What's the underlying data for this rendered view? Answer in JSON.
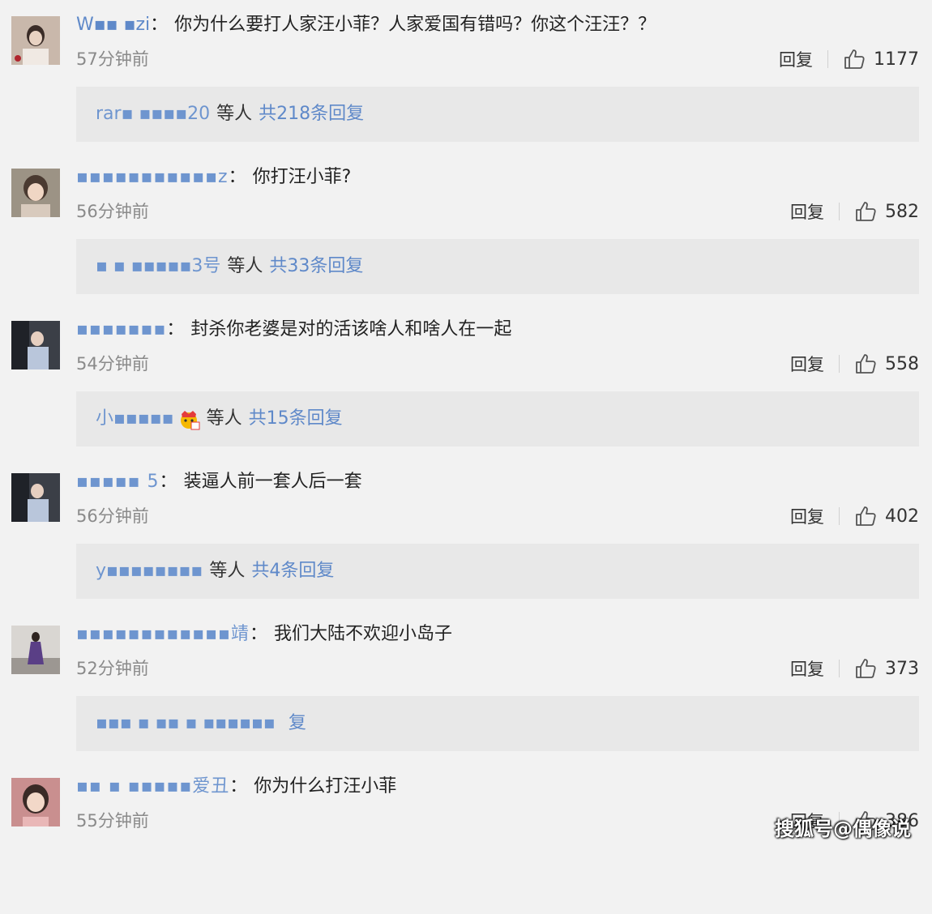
{
  "comments": [
    {
      "username": "W▪▪ ▪zi",
      "text": "你为什么要打人家汪小菲？人家爱国有错吗？你这个汪汪？？",
      "time": "57分钟前",
      "reply_label": "回复",
      "likes": "1177",
      "reply_summary": {
        "replier": "rar▪ ▪▪▪▪20",
        "etc": "等人",
        "total": "共218条回复"
      }
    },
    {
      "username": "▪▪▪▪▪▪▪▪▪▪▪z",
      "text": "你打汪小菲?",
      "time": "56分钟前",
      "reply_label": "回复",
      "likes": "582",
      "reply_summary": {
        "replier": "▪  ▪  ▪▪▪▪▪3号",
        "etc": "等人",
        "total": "共33条回复"
      }
    },
    {
      "username": "▪▪▪▪▪▪▪",
      "text": "封杀你老婆是对的活该啥人和啥人在一起",
      "time": "54分钟前",
      "reply_label": "回复",
      "likes": "558",
      "reply_summary": {
        "replier": "小▪▪▪▪▪",
        "etc": "等人",
        "total": "共15条回复"
      }
    },
    {
      "username": "▪▪▪▪▪   5",
      "text": "装逼人前一套人后一套",
      "time": "56分钟前",
      "reply_label": "回复",
      "likes": "402",
      "reply_summary": {
        "replier": "y▪▪▪▪▪▪▪▪",
        "etc": "等人",
        "total": "共4条回复"
      }
    },
    {
      "username": "▪▪▪▪▪▪▪▪▪▪▪▪靖",
      "text": "我们大陆不欢迎小岛子",
      "time": "52分钟前",
      "reply_label": "回复",
      "likes": "373",
      "reply_summary": {
        "replier": "▪▪▪ ▪ ▪▪   ▪   ▪▪▪▪▪▪",
        "etc": "",
        "total": "复"
      }
    },
    {
      "username": "▪▪   ▪   ▪▪▪▪▪爱丑",
      "text": "你为什么打汪小菲",
      "time": "55分钟前",
      "reply_label": "回复",
      "likes": "386",
      "reply_summary": null
    }
  ],
  "watermark": "搜狐号@偶像说",
  "colors": {
    "link": "#5f89c9",
    "time": "#8a8a8a",
    "reply_bg": "#e8e8e8",
    "page_bg": "#f2f2f2"
  },
  "icons": {
    "like": "thumbs-up-icon",
    "emoji": "crown-emoji-icon"
  }
}
